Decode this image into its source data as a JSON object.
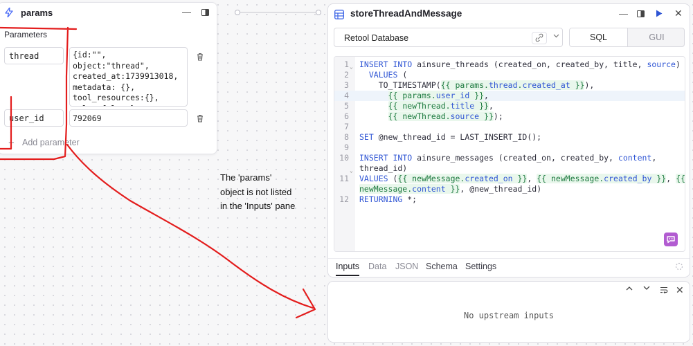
{
  "params_panel": {
    "title": "params",
    "section_label": "Parameters",
    "params": [
      {
        "name": "thread",
        "value": "{id:\"\", object:\"thread\",\ncreated_at:1739913018,\nmetadata: {},\ntool_resources:{},\nvalue:false }"
      },
      {
        "name": "user_id",
        "value": "792069"
      }
    ],
    "add_label": "Add parameter"
  },
  "query": {
    "title": "storeThreadAndMessage",
    "resource": "Retool Database",
    "modes": {
      "sql": "SQL",
      "gui": "GUI"
    },
    "tabs": [
      "Inputs",
      "Data",
      "JSON",
      "Schema",
      "Settings"
    ],
    "active_tab": "Inputs"
  },
  "inputs_pane": {
    "empty_message": "No upstream inputs"
  },
  "annotation": {
    "text": "The 'params' object is not listed in the 'Inputs' pane"
  },
  "colors": {
    "accent": "#2f55d4",
    "annotation": "#e31d1d",
    "template_highlight": "#e9f7ec",
    "badge": "#b25cd1"
  }
}
